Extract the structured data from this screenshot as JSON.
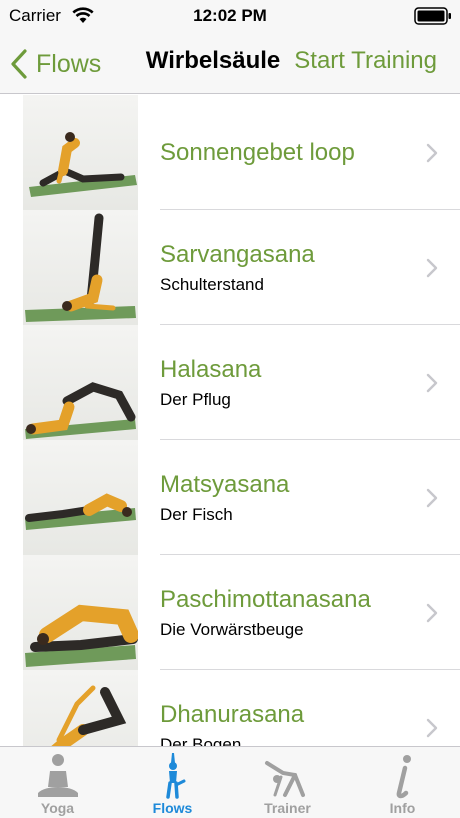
{
  "status_bar": {
    "carrier": "Carrier",
    "time": "12:02 PM"
  },
  "nav": {
    "back_label": "Flows",
    "title": "Wirbelsäule",
    "action_label": "Start Training"
  },
  "colors": {
    "accent_green": "#6e9b3b",
    "tab_active": "#1e8ad9",
    "tab_inactive": "#a0a0a0",
    "mat": "#6f9a5a",
    "shirt": "#e4a12a",
    "pants": "#2d2a27"
  },
  "list": {
    "items": [
      {
        "title": "Sonnengebet loop",
        "subtitle": "",
        "pose_icon": "sun-salutation-pose"
      },
      {
        "title": "Sarvangasana",
        "subtitle": "Schulterstand",
        "pose_icon": "shoulder-stand-pose"
      },
      {
        "title": "Halasana",
        "subtitle": "Der Pflug",
        "pose_icon": "plough-pose"
      },
      {
        "title": "Matsyasana",
        "subtitle": "Der Fisch",
        "pose_icon": "fish-pose"
      },
      {
        "title": "Paschimottanasana",
        "subtitle": "Die Vorwärstbeuge",
        "pose_icon": "forward-bend-pose"
      },
      {
        "title": "Dhanurasana",
        "subtitle": "Der Bogen",
        "pose_icon": "bow-pose"
      }
    ]
  },
  "tabs": [
    {
      "label": "Yoga",
      "icon": "meditation-icon",
      "active": false
    },
    {
      "label": "Flows",
      "icon": "standing-figure-icon",
      "active": true
    },
    {
      "label": "Trainer",
      "icon": "stretching-figure-icon",
      "active": false
    },
    {
      "label": "Info",
      "icon": "info-icon",
      "active": false
    }
  ]
}
